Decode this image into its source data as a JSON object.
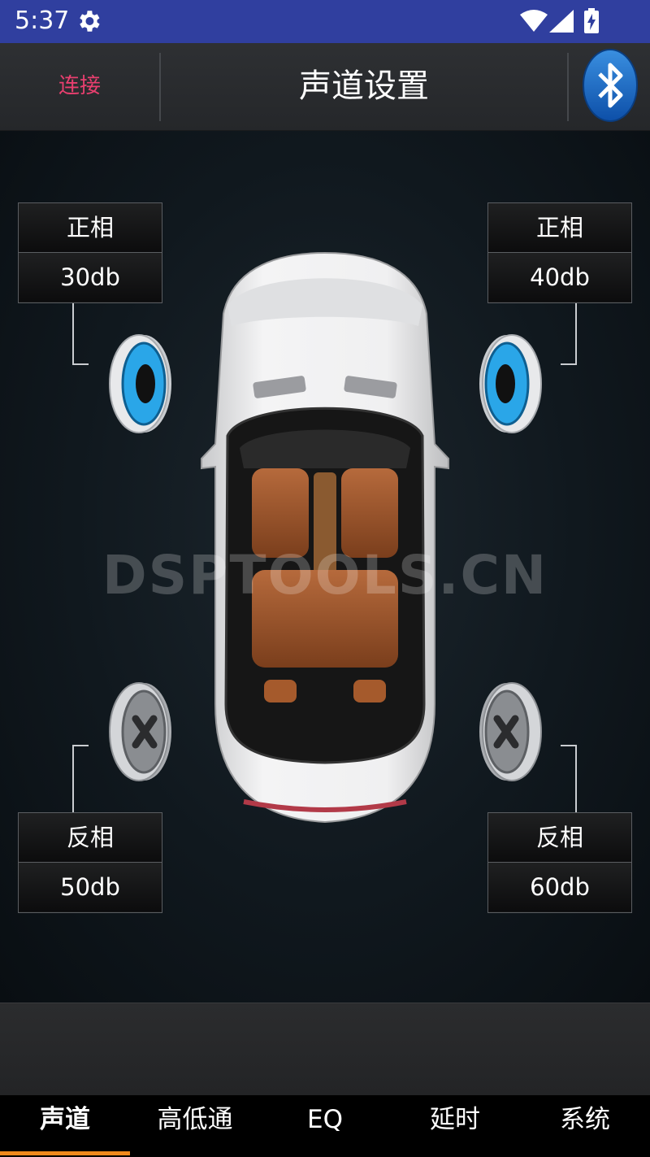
{
  "status_bar": {
    "time": "5:37",
    "icons": [
      "gear-icon",
      "wifi-icon",
      "signal-icon",
      "battery-charging-icon"
    ]
  },
  "header": {
    "connect_label": "连接",
    "title": "声道设置",
    "bluetooth_icon": "bluetooth-icon"
  },
  "channels": {
    "front_left": {
      "phase": "正相",
      "gain": "30db",
      "speaker_active": true
    },
    "front_right": {
      "phase": "正相",
      "gain": "40db",
      "speaker_active": true
    },
    "rear_left": {
      "phase": "反相",
      "gain": "50db",
      "speaker_active": false
    },
    "rear_right": {
      "phase": "反相",
      "gain": "60db",
      "speaker_active": false
    }
  },
  "watermark": "DSPTOOLS.CN",
  "bottom_nav": {
    "tabs": [
      "声道",
      "高低通",
      "EQ",
      "延时",
      "系统"
    ],
    "active_index": 0
  },
  "colors": {
    "status_bar": "#303f9f",
    "connect_text": "#e83f6f",
    "active_indicator": "#f08a1c",
    "speaker_active_cone": "#2aa6e8"
  }
}
